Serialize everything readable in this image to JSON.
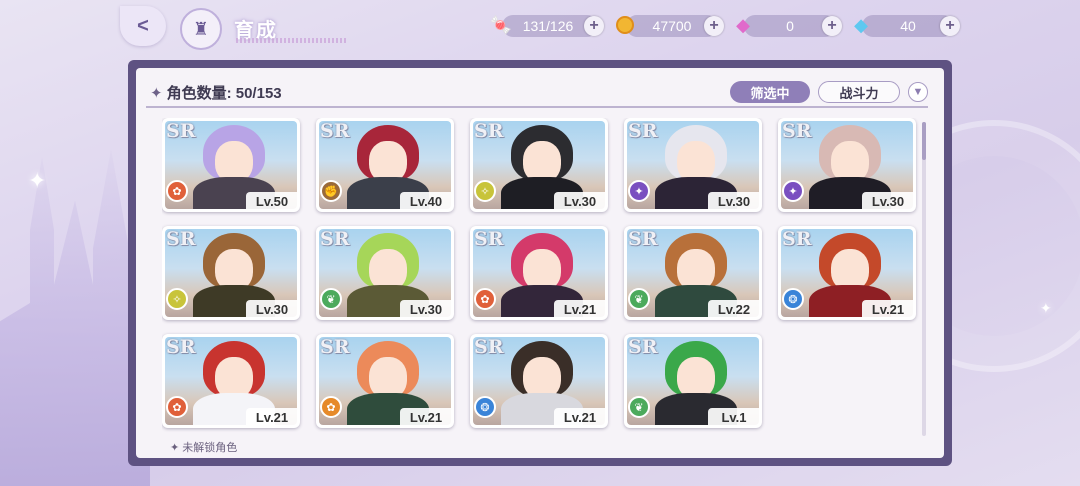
{
  "header": {
    "title": "育成"
  },
  "resources": [
    {
      "name": "stamina",
      "icon": "candy-icon",
      "value": "131/126"
    },
    {
      "name": "gold",
      "icon": "coin-icon",
      "value": "47700"
    },
    {
      "name": "pink-gem",
      "icon": "pink-diamond-icon",
      "value": "0"
    },
    {
      "name": "blue-gem",
      "icon": "blue-diamond-icon",
      "value": "40"
    }
  ],
  "roster": {
    "count_label": "角色数量:",
    "count_value": "50/153",
    "filter_label": "筛选中",
    "sort_label": "战斗力",
    "cut_label": "未解锁角色"
  },
  "cards": [
    {
      "rarity": "SR",
      "level": "Lv.50",
      "element": "fire",
      "elem_color": "#e0603a",
      "hair": "#b8a4e6",
      "outfit": "#4a4250"
    },
    {
      "rarity": "SR",
      "level": "Lv.40",
      "element": "earth",
      "elem_color": "#9a6a3a",
      "hair": "#a8263a",
      "outfit": "#3b3f4a"
    },
    {
      "rarity": "SR",
      "level": "Lv.30",
      "element": "wind",
      "elem_color": "#c8c43a",
      "hair": "#2c2c30",
      "outfit": "#1e1e24"
    },
    {
      "rarity": "SR",
      "level": "Lv.30",
      "element": "dark",
      "elem_color": "#7a4fc0",
      "hair": "#e6e6ee",
      "outfit": "#2c2436"
    },
    {
      "rarity": "SR",
      "level": "Lv.30",
      "element": "dark",
      "elem_color": "#7a4fc0",
      "hair": "#d8b9b4",
      "outfit": "#1f1d26"
    },
    {
      "rarity": "SR",
      "level": "Lv.30",
      "element": "wind",
      "elem_color": "#c8c43a",
      "hair": "#9a6638",
      "outfit": "#3e3a26"
    },
    {
      "rarity": "SR",
      "level": "Lv.30",
      "element": "nature",
      "elem_color": "#4caa5c",
      "hair": "#a6d659",
      "outfit": "#5b5a36"
    },
    {
      "rarity": "SR",
      "level": "Lv.21",
      "element": "fire",
      "elem_color": "#e0603a",
      "hair": "#d43a6a",
      "outfit": "#33263a"
    },
    {
      "rarity": "SR",
      "level": "Lv.22",
      "element": "nature",
      "elem_color": "#4caa5c",
      "hair": "#b8703a",
      "outfit": "#2f4a3e"
    },
    {
      "rarity": "SR",
      "level": "Lv.21",
      "element": "water",
      "elem_color": "#3a84d8",
      "hair": "#c4492a",
      "outfit": "#8e1f24"
    },
    {
      "rarity": "SR",
      "level": "Lv.21",
      "element": "fire",
      "elem_color": "#e0603a",
      "hair": "#c8342f",
      "outfit": "#f4f4f8"
    },
    {
      "rarity": "SR",
      "level": "Lv.21",
      "element": "fire",
      "elem_color": "#e68a2a",
      "hair": "#ec8a5a",
      "outfit": "#2f4c3c"
    },
    {
      "rarity": "SR",
      "level": "Lv.21",
      "element": "water",
      "elem_color": "#3a84d8",
      "hair": "#3a2e28",
      "outfit": "#d8d8de"
    },
    {
      "rarity": "SR",
      "level": "Lv.1",
      "element": "nature",
      "elem_color": "#4caa5c",
      "hair": "#3aa84a",
      "outfit": "#2a2a30"
    }
  ],
  "colors": {
    "panel_frame": "#5e5282",
    "filter_active": "#8f7fb8",
    "panel_bg": "#f6f3f8"
  }
}
